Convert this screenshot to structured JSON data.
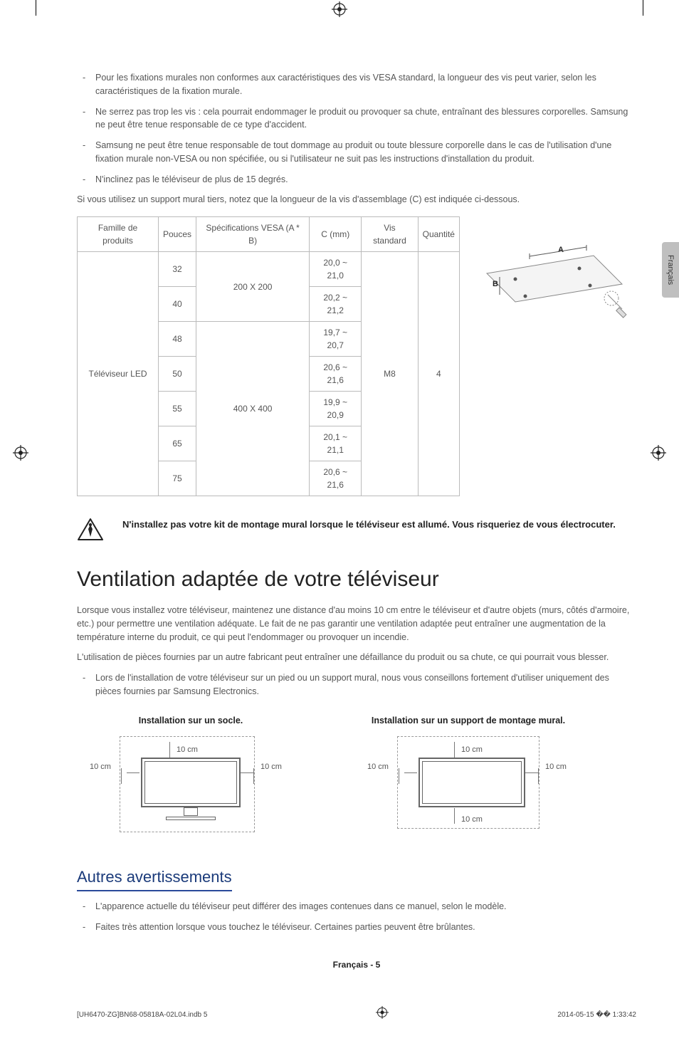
{
  "lang_tab": "Français",
  "bullets_top": [
    "Pour les fixations murales non conformes aux caractéristiques des vis VESA standard, la longueur des vis peut varier, selon les caractéristiques de la fixation murale.",
    "Ne serrez pas trop les vis : cela pourrait endommager le produit ou provoquer sa chute, entraînant des blessures corporelles. Samsung ne peut être tenue responsable de ce type d'accident.",
    "Samsung ne peut être tenue responsable de tout dommage au produit ou toute blessure corporelle dans le cas de l'utilisation d'une fixation murale non-VESA ou non spécifiée, ou si l'utilisateur ne suit pas les instructions d'installation du produit.",
    "N'inclinez pas le téléviseur de plus de 15 degrés."
  ],
  "intro_line": "Si vous utilisez un support mural tiers, notez que la longueur de la vis d'assemblage (C) est indiquée ci-dessous.",
  "table": {
    "headers": {
      "family": "Famille de produits",
      "inches": "Pouces",
      "vesa": "Spécifications VESA (A * B)",
      "c": "C (mm)",
      "screw": "Vis standard",
      "qty": "Quantité"
    },
    "family_value": "Téléviseur LED",
    "screw_value": "M8",
    "qty_value": "4",
    "rows": [
      {
        "inches": "32",
        "vesa": "200 X 200",
        "c": "20,0 ~ 21,0"
      },
      {
        "inches": "40",
        "vesa": "",
        "c": "20,2 ~ 21,2"
      },
      {
        "inches": "48",
        "vesa": "400 X 400",
        "c": "19,7 ~ 20,7"
      },
      {
        "inches": "50",
        "vesa": "",
        "c": "20,6 ~ 21,6"
      },
      {
        "inches": "55",
        "vesa": "",
        "c": "19,9 ~ 20,9"
      },
      {
        "inches": "65",
        "vesa": "",
        "c": "20,1 ~ 21,1"
      },
      {
        "inches": "75",
        "vesa": "",
        "c": "20,6 ~ 21,6"
      }
    ]
  },
  "diagram_labels": {
    "a": "A",
    "b": "B"
  },
  "warning": "N'installez pas votre kit de montage mural lorsque le téléviseur est allumé. Vous risqueriez de vous électrocuter.",
  "h1": "Ventilation adaptée de votre téléviseur",
  "para1": "Lorsque vous installez votre téléviseur, maintenez une distance d'au moins 10 cm entre le téléviseur et d'autre objets (murs, côtés d'armoire, etc.) pour permettre une ventilation adéquate. Le fait de ne pas garantir une ventilation adaptée peut entraîner une augmentation de la température interne du produit, ce qui peut l'endommager ou provoquer un incendie.",
  "para2": "L'utilisation de pièces fournies par un autre fabricant peut entraîner une défaillance du produit ou sa chute, ce qui pourrait vous blesser.",
  "bullets_mid": [
    "Lors de l'installation de votre téléviseur sur un pied ou un support mural, nous vous conseillons fortement d'utiliser uniquement des pièces fournies par Samsung Electronics."
  ],
  "fig1_caption": "Installation sur un socle.",
  "fig2_caption": "Installation sur un support de montage mural.",
  "dim_label": "10 cm",
  "h2": "Autres avertissements",
  "bullets_bottom": [
    "L'apparence actuelle du téléviseur peut différer des images contenues dans ce manuel, selon le modèle.",
    "Faites très attention lorsque vous touchez le téléviseur. Certaines parties peuvent être brûlantes."
  ],
  "footer_center": "Français - 5",
  "footer_file": "[UH6470-ZG]BN68-05818A-02L04.indb   5",
  "footer_time": "2014-05-15   �� 1:33:42"
}
